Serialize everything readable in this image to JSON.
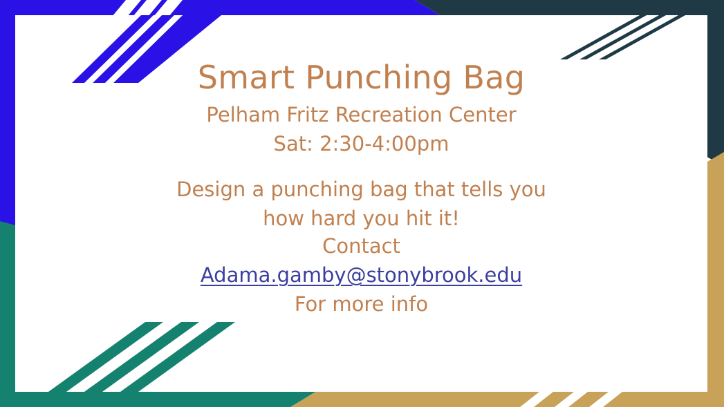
{
  "slide": {
    "title": "Smart Punching Bag",
    "venue": "Pelham Fritz Recreation Center",
    "time": "Sat: 2:30-4:00pm",
    "description_line1": "Design a punching bag that tells you",
    "description_line2": "how hard you hit it!",
    "contact_label": "Contact",
    "contact_email": "Adama.gamby@stonybrook.edu",
    "more_info": "For more info"
  },
  "colors": {
    "text": "#c0804f",
    "link": "#3b3fa0",
    "blue_corner": "#2a12e6",
    "dark_corner": "#1f3a44",
    "gold_corner": "#c9a25a",
    "teal_corner": "#14826e"
  }
}
